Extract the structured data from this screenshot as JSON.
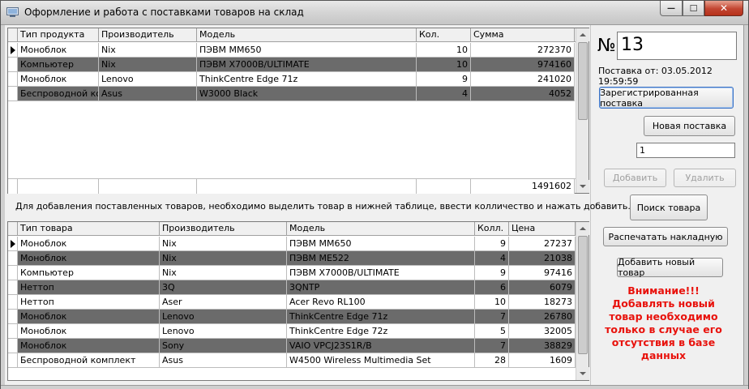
{
  "window": {
    "title": "Оформление и работа с поставками товаров на склад",
    "min_glyph": "—",
    "max_glyph": "☐",
    "close_glyph": "✕"
  },
  "top_grid": {
    "columns": [
      "Тип продукта",
      "Производитель",
      "Модель",
      "Кол.",
      "Сумма"
    ],
    "rows": [
      {
        "type": "Моноблок",
        "maker": "Nix",
        "model": "ПЭВМ ММ650",
        "qty": "10",
        "sum": "272370",
        "dark": false,
        "current": true
      },
      {
        "type": "Компьютер",
        "maker": "Nix",
        "model": "ПЭВМ X7000B/ULTIMATE",
        "qty": "10",
        "sum": "974160",
        "dark": true,
        "current": false
      },
      {
        "type": "Моноблок",
        "maker": "Lenovo",
        "model": "ThinkCentre Edge 71z",
        "qty": "9",
        "sum": "241020",
        "dark": false,
        "current": false
      },
      {
        "type": "Беспроводной комплект",
        "maker": "Asus",
        "model": "W3000 Black",
        "qty": "4",
        "sum": "4052",
        "dark": true,
        "current": false
      }
    ],
    "total": "1491602"
  },
  "hint_text": "Для добавления поставленных товаров, необходимо выделить товар в нижней таблице, ввести колличество и нажать добавить...",
  "bottom_grid": {
    "columns": [
      "Тип товара",
      "Производитель",
      "Модель",
      "Колл.",
      "Цена"
    ],
    "rows": [
      {
        "type": "Моноблок",
        "maker": "Nix",
        "model": "ПЭВМ ММ650",
        "qty": "9",
        "price": "27237",
        "dark": false,
        "current": true
      },
      {
        "type": "Моноблок",
        "maker": "Nix",
        "model": "ПЭВМ МЕ522",
        "qty": "4",
        "price": "21038",
        "dark": true,
        "current": false
      },
      {
        "type": "Компьютер",
        "maker": "Nix",
        "model": "ПЭВМ X7000B/ULTIMATE",
        "qty": "9",
        "price": "97416",
        "dark": false,
        "current": false
      },
      {
        "type": "Неттоп",
        "maker": "3Q",
        "model": "3QNTP",
        "qty": "6",
        "price": "6079",
        "dark": true,
        "current": false
      },
      {
        "type": "Неттоп",
        "maker": "Aser",
        "model": "Acer Revo RL100",
        "qty": "10",
        "price": "18273",
        "dark": false,
        "current": false
      },
      {
        "type": "Моноблок",
        "maker": "Lenovo",
        "model": "ThinkCentre Edge 71z",
        "qty": "7",
        "price": "26780",
        "dark": true,
        "current": false
      },
      {
        "type": "Моноблок",
        "maker": "Lenovo",
        "model": "ThinkCentre Edge 72z",
        "qty": "5",
        "price": "32005",
        "dark": false,
        "current": false
      },
      {
        "type": "Моноблок",
        "maker": "Sony",
        "model": "VAIO VPCJ23S1R/B",
        "qty": "7",
        "price": "38829",
        "dark": true,
        "current": false
      },
      {
        "type": "Беспроводной комплект",
        "maker": "Asus",
        "model": "W4500 Wireless Multimedia Set",
        "qty": "28",
        "price": "1609",
        "dark": false,
        "current": false
      }
    ]
  },
  "side": {
    "number_sign": "№",
    "number_value": "13",
    "date_label": "Поставка от: 03.05.2012 19:59:59",
    "registered_button": "Зарегистрированная поставка",
    "new_delivery_button": "Новая поставка",
    "quantity_value": "1",
    "add_button": "Добавить",
    "delete_button": "Удалить",
    "search_button": "Поиск товара",
    "print_button": "Распечатать накладную",
    "add_new_item_button": "Добавить новый товар",
    "warning_text": "Внимание!!! Добавлять новый товар необходимо только в случае его отсутствия в базе данных"
  },
  "colors": {
    "dark_row": "#6b6b6b",
    "warning": "#e8120c",
    "close_button": "#c24531"
  }
}
